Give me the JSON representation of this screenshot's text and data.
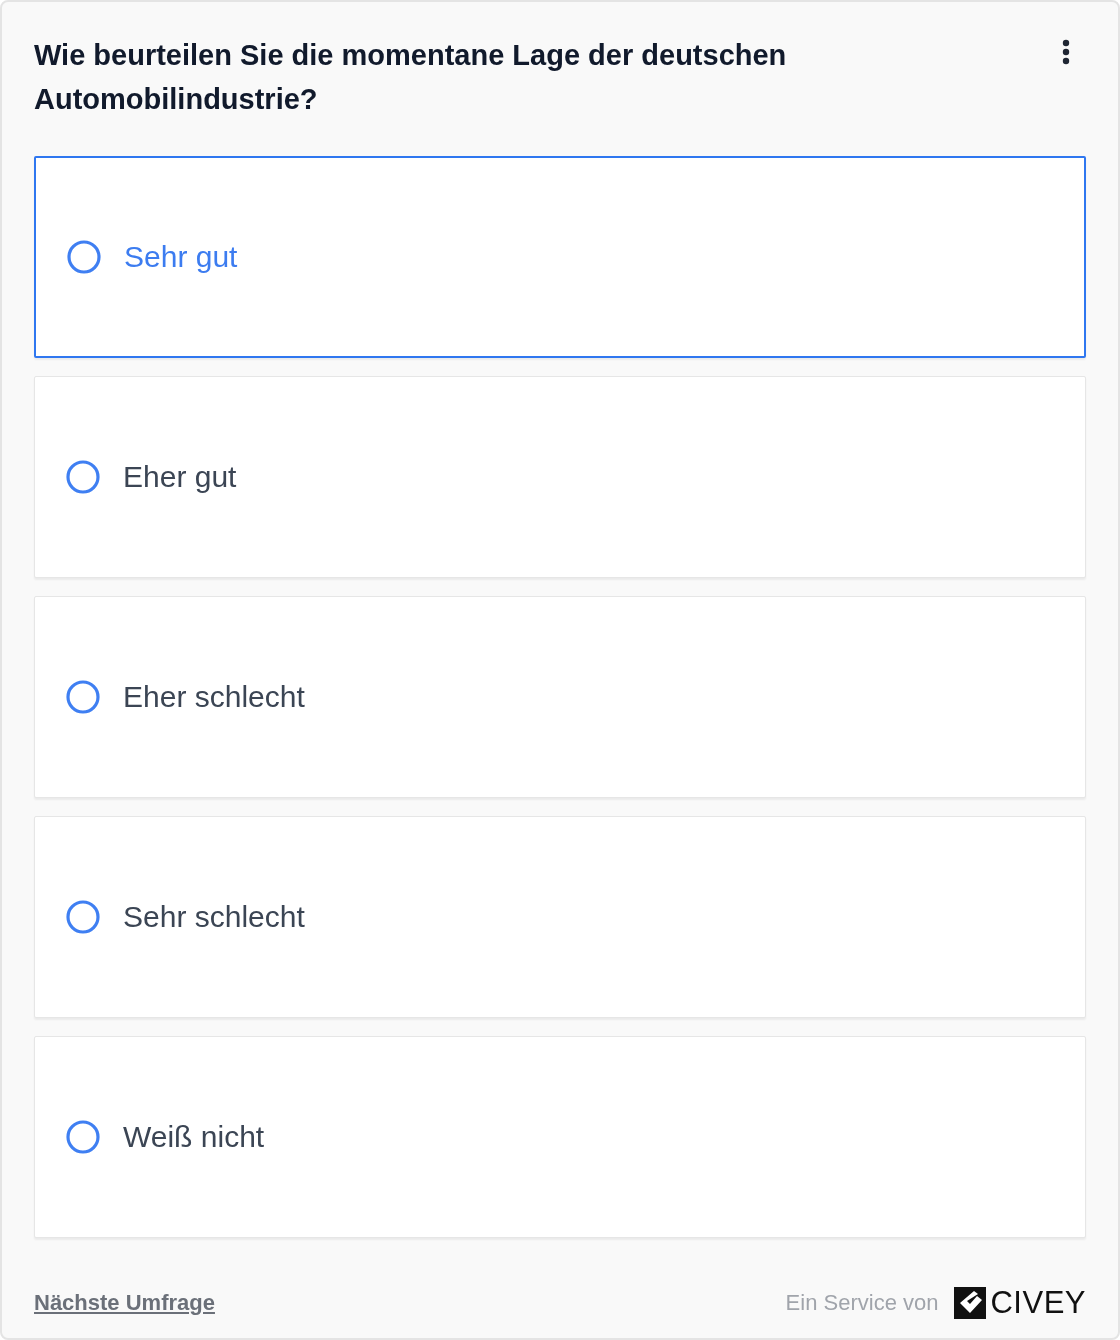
{
  "question": "Wie beurteilen Sie die momentane Lage der deutschen Automobilindustrie?",
  "options": [
    {
      "label": "Sehr gut",
      "selected": false,
      "highlighted": true
    },
    {
      "label": "Eher gut",
      "selected": false,
      "highlighted": false
    },
    {
      "label": "Eher schlecht",
      "selected": false,
      "highlighted": false
    },
    {
      "label": "Sehr schlecht",
      "selected": false,
      "highlighted": false
    },
    {
      "label": "Weiß nicht",
      "selected": false,
      "highlighted": false
    }
  ],
  "footer": {
    "next_link": "Nächste Umfrage",
    "service_text": "Ein Service von",
    "brand": "CIVEY"
  }
}
